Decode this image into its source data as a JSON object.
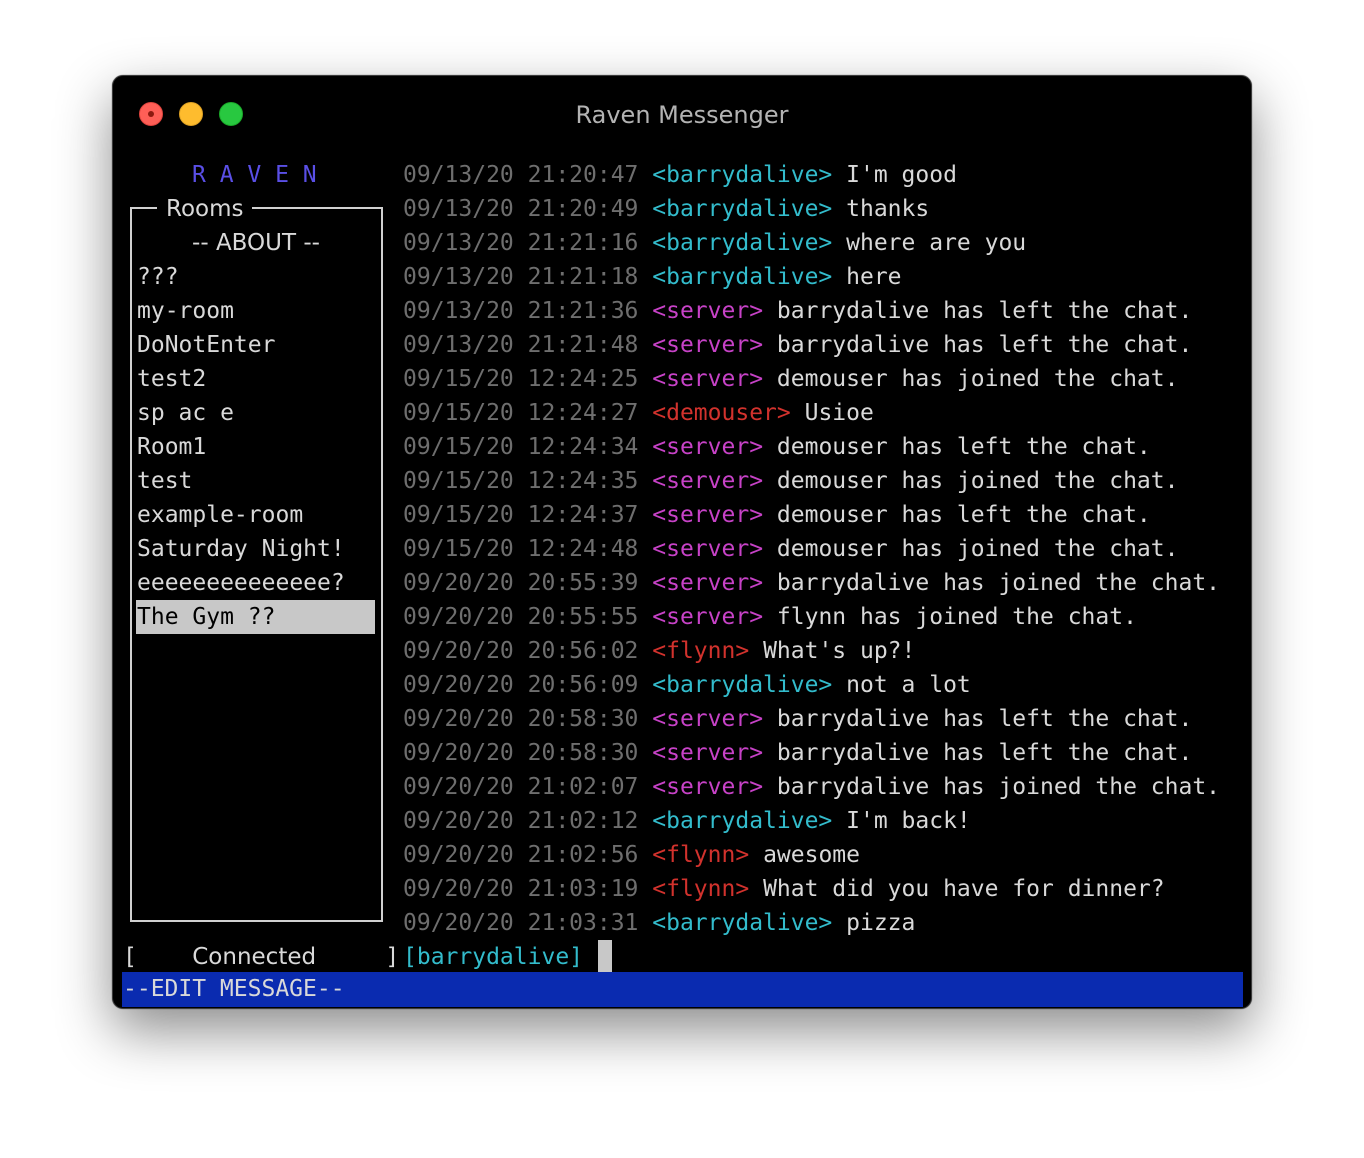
{
  "window": {
    "title": "Raven Messenger"
  },
  "sidebar": {
    "logo": "R A V E N",
    "rooms_title": "Rooms",
    "rooms": [
      {
        "label": "-- ABOUT --"
      },
      {
        "label": "???"
      },
      {
        "label": "my-room"
      },
      {
        "label": "DoNotEnter"
      },
      {
        "label": "test2"
      },
      {
        "label": "sp ac e"
      },
      {
        "label": "Room1"
      },
      {
        "label": "test"
      },
      {
        "label": "example-room"
      },
      {
        "label": "Saturday Night!"
      },
      {
        "label": "eeeeeeeeeeeeee?"
      },
      {
        "label": "The Gym ??"
      }
    ],
    "selected_room": "The Gym ??"
  },
  "messages": [
    {
      "timestamp": "09/13/20 21:20:47",
      "nick": "<barrydalive>",
      "text": "I'm good",
      "nick_color": "cyan"
    },
    {
      "timestamp": "09/13/20 21:20:49",
      "nick": "<barrydalive>",
      "text": "thanks",
      "nick_color": "cyan"
    },
    {
      "timestamp": "09/13/20 21:21:16",
      "nick": "<barrydalive>",
      "text": "where are you",
      "nick_color": "cyan"
    },
    {
      "timestamp": "09/13/20 21:21:18",
      "nick": "<barrydalive>",
      "text": "here",
      "nick_color": "cyan"
    },
    {
      "timestamp": "09/13/20 21:21:36",
      "nick": "<server>",
      "text": "barrydalive has left the chat.",
      "nick_color": "magenta"
    },
    {
      "timestamp": "09/13/20 21:21:48",
      "nick": "<server>",
      "text": "barrydalive has left the chat.",
      "nick_color": "magenta"
    },
    {
      "timestamp": "09/15/20 12:24:25",
      "nick": "<server>",
      "text": "demouser has joined the chat.",
      "nick_color": "magenta"
    },
    {
      "timestamp": "09/15/20 12:24:27",
      "nick": "<demouser>",
      "text": "Usioe",
      "nick_color": "red"
    },
    {
      "timestamp": "09/15/20 12:24:34",
      "nick": "<server>",
      "text": "demouser has left the chat.",
      "nick_color": "magenta"
    },
    {
      "timestamp": "09/15/20 12:24:35",
      "nick": "<server>",
      "text": "demouser has joined the chat.",
      "nick_color": "magenta"
    },
    {
      "timestamp": "09/15/20 12:24:37",
      "nick": "<server>",
      "text": "demouser has left the chat.",
      "nick_color": "magenta"
    },
    {
      "timestamp": "09/15/20 12:24:48",
      "nick": "<server>",
      "text": "demouser has joined the chat.",
      "nick_color": "magenta"
    },
    {
      "timestamp": "09/20/20 20:55:39",
      "nick": "<server>",
      "text": "barrydalive has joined the chat.",
      "nick_color": "magenta"
    },
    {
      "timestamp": "09/20/20 20:55:55",
      "nick": "<server>",
      "text": "flynn has joined the chat.",
      "nick_color": "magenta"
    },
    {
      "timestamp": "09/20/20 20:56:02",
      "nick": "<flynn>",
      "text": "What's up?!",
      "nick_color": "red"
    },
    {
      "timestamp": "09/20/20 20:56:09",
      "nick": "<barrydalive>",
      "text": "not a lot",
      "nick_color": "cyan"
    },
    {
      "timestamp": "09/20/20 20:58:30",
      "nick": "<server>",
      "text": "barrydalive has left the chat.",
      "nick_color": "magenta"
    },
    {
      "timestamp": "09/20/20 20:58:30",
      "nick": "<server>",
      "text": "barrydalive has left the chat.",
      "nick_color": "magenta"
    },
    {
      "timestamp": "09/20/20 21:02:07",
      "nick": "<server>",
      "text": "barrydalive has joined the chat.",
      "nick_color": "magenta"
    },
    {
      "timestamp": "09/20/20 21:02:12",
      "nick": "<barrydalive>",
      "text": "I'm back!",
      "nick_color": "cyan"
    },
    {
      "timestamp": "09/20/20 21:02:56",
      "nick": "<flynn>",
      "text": "awesome",
      "nick_color": "red"
    },
    {
      "timestamp": "09/20/20 21:03:19",
      "nick": "<flynn>",
      "text": "What did you have for dinner?",
      "nick_color": "red"
    },
    {
      "timestamp": "09/20/20 21:03:31",
      "nick": "<barrydalive>",
      "text": "pizza",
      "nick_color": "cyan"
    }
  ],
  "status": {
    "open_bracket": "[",
    "text": "Connected",
    "close_bracket": "]"
  },
  "input": {
    "prompt": "[barrydalive]",
    "value": ""
  },
  "mode_bar": {
    "label": "--EDIT MESSAGE--",
    "color": "#0a2bb0"
  },
  "colors": {
    "cyan": "#33bccc",
    "magenta": "#c742c7",
    "red": "#d2322d",
    "logo": "#5a4fe6",
    "timestamp": "#6e6e6e"
  }
}
